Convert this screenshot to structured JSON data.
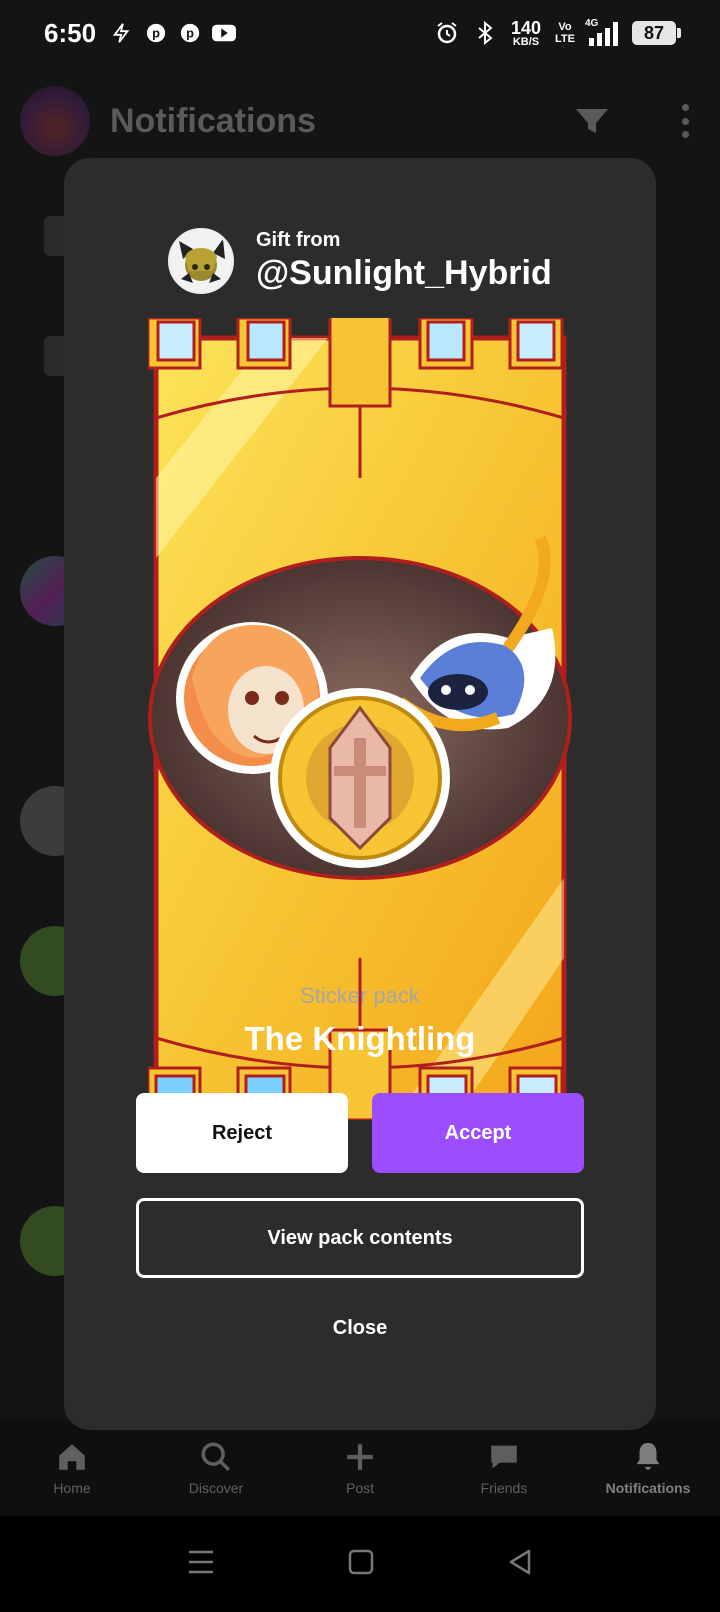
{
  "status_bar": {
    "time": "6:50",
    "net_speed_value": "140",
    "net_speed_unit": "KB/S",
    "volte_top": "Vo",
    "volte_bottom": "LTE",
    "network_type": "4G",
    "battery": "87"
  },
  "background": {
    "title": "Notifications",
    "nav": [
      {
        "label": "Home",
        "icon": "home-icon"
      },
      {
        "label": "Discover",
        "icon": "search-icon"
      },
      {
        "label": "Post",
        "icon": "plus-icon"
      },
      {
        "label": "Friends",
        "icon": "chat-icon"
      },
      {
        "label": "Notifications",
        "icon": "bell-icon",
        "active": true
      }
    ]
  },
  "gift": {
    "from_label": "Gift from",
    "username": "@Sunlight_Hybrid",
    "pack_type": "Sticker pack",
    "pack_name": "The Knightling",
    "reject_label": "Reject",
    "accept_label": "Accept",
    "view_label": "View pack contents",
    "close_label": "Close"
  },
  "colors": {
    "modal_bg": "#2c2d2b",
    "accent": "#9b4dff",
    "pack_gold": "#f7c533",
    "pack_border": "#b01e1e"
  }
}
